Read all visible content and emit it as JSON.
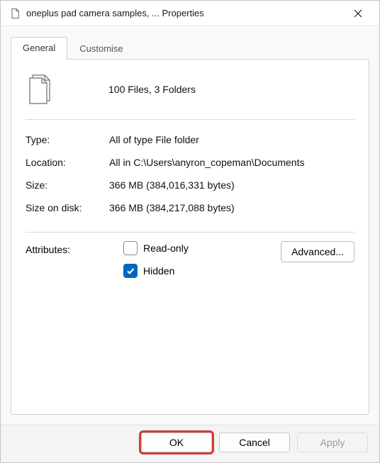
{
  "title": "oneplus pad camera samples, ... Properties",
  "tabs": {
    "general": "General",
    "customise": "Customise"
  },
  "summary": "100 Files, 3 Folders",
  "properties": {
    "type_label": "Type:",
    "type_value": "All of type File folder",
    "location_label": "Location:",
    "location_value": "All in C:\\Users\\anyron_copeman\\Documents",
    "size_label": "Size:",
    "size_value": "366 MB (384,016,331 bytes)",
    "sizeondisk_label": "Size on disk:",
    "sizeondisk_value": "366 MB (384,217,088 bytes)"
  },
  "attributes": {
    "label": "Attributes:",
    "readonly_label": "Read-only",
    "readonly_checked": false,
    "hidden_label": "Hidden",
    "hidden_checked": true,
    "advanced_label": "Advanced..."
  },
  "footer": {
    "ok": "OK",
    "cancel": "Cancel",
    "apply": "Apply"
  }
}
